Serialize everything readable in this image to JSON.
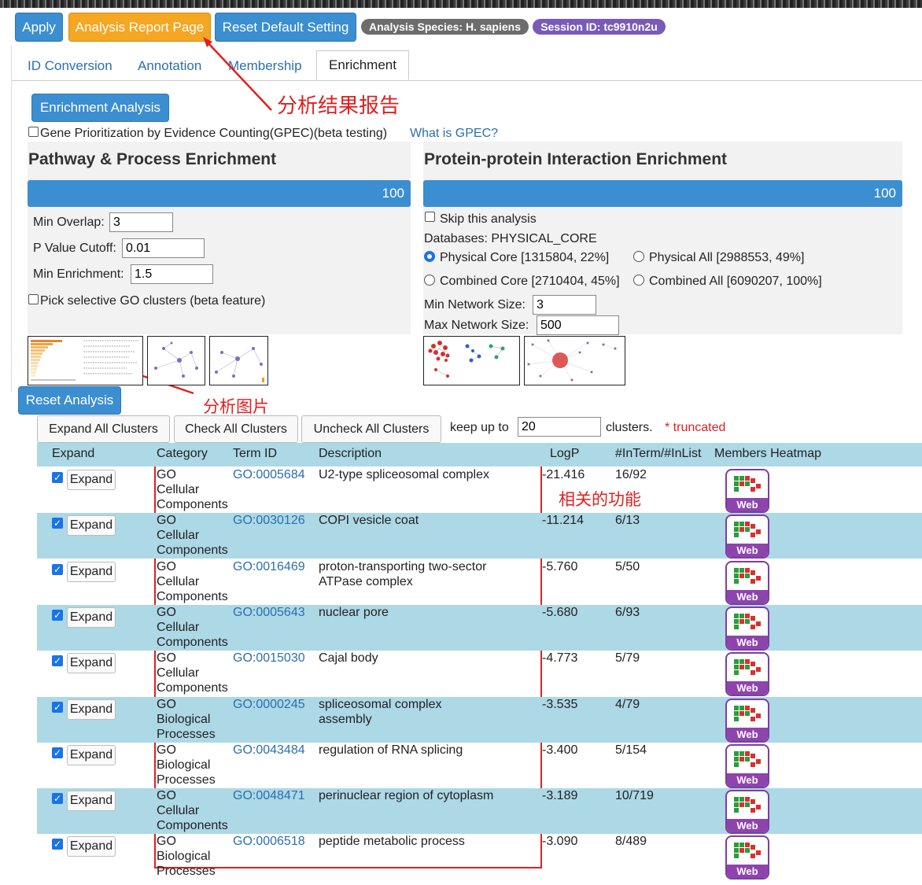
{
  "toolbar": {
    "apply": "Apply",
    "report": "Analysis Report Page",
    "reset_default": "Reset Default Setting",
    "species_badge": "Analysis Species: H. sapiens",
    "session_badge": "Session ID: tc9910n2u"
  },
  "tabs": [
    "ID Conversion",
    "Annotation",
    "Membership",
    "Enrichment"
  ],
  "enrichment": {
    "button": "Enrichment Analysis",
    "gpec_label": "Gene Prioritization by Evidence Counting(GPEC)(beta testing)",
    "gpec_link": "What is GPEC?"
  },
  "pathway": {
    "title": "Pathway & Process Enrichment",
    "progress": "100",
    "min_overlap_label": "Min Overlap:",
    "min_overlap": "3",
    "pvalue_label": "P Value Cutoff:",
    "pvalue": "0.01",
    "min_enrich_label": "Min Enrichment:",
    "min_enrich": "1.5",
    "pick_label": "Pick selective GO clusters (beta feature)"
  },
  "ppi": {
    "title": "Protein-protein Interaction Enrichment",
    "progress": "100",
    "skip_label": "Skip this analysis",
    "databases": "Databases: PHYSICAL_CORE",
    "opt1": "Physical Core [1315804, 22%]",
    "opt2": "Physical All [2988553, 49%]",
    "opt3": "Combined Core [2710404, 45%]",
    "opt4": "Combined All [6090207, 100%]",
    "min_net_label": "Min Network Size:",
    "min_net": "3",
    "max_net_label": "Max Network Size:",
    "max_net": "500"
  },
  "annotations": {
    "report_note": "分析结果报告",
    "image_note": "分析图片",
    "function_note": "相关的功能"
  },
  "controls": {
    "reset_analysis": "Reset Analysis",
    "expand_all": "Expand All Clusters",
    "check_all": "Check All Clusters",
    "uncheck_all": "Uncheck All Clusters",
    "keep_up_to": "keep up to",
    "keep_value": "20",
    "clusters": "clusters.",
    "truncated": "* truncated"
  },
  "table": {
    "headers": [
      "Expand",
      "Category",
      "Term ID",
      "Description",
      "LogP",
      "#InTerm/#InList",
      "Members Heatmap"
    ],
    "expand_label": "Expand",
    "web_label": "Web",
    "rows": [
      {
        "cat": [
          "GO",
          "Cellular",
          "Components"
        ],
        "term": "GO:0005684",
        "desc": [
          "U2-type spliceosomal complex"
        ],
        "logp": "-21.416",
        "ratio": "16/92"
      },
      {
        "cat": [
          "GO",
          "Cellular",
          "Components"
        ],
        "term": "GO:0030126",
        "desc": [
          "COPI vesicle coat"
        ],
        "logp": "-11.214",
        "ratio": "6/13"
      },
      {
        "cat": [
          "GO",
          "Cellular",
          "Components"
        ],
        "term": "GO:0016469",
        "desc": [
          "proton-transporting two-sector",
          "ATPase complex"
        ],
        "logp": "-5.760",
        "ratio": "5/50"
      },
      {
        "cat": [
          "GO",
          "Cellular",
          "Components"
        ],
        "term": "GO:0005643",
        "desc": [
          "nuclear pore"
        ],
        "logp": "-5.680",
        "ratio": "6/93"
      },
      {
        "cat": [
          "GO",
          "Cellular",
          "Components"
        ],
        "term": "GO:0015030",
        "desc": [
          "Cajal body"
        ],
        "logp": "-4.773",
        "ratio": "5/79"
      },
      {
        "cat": [
          "GO",
          "Biological",
          "Processes"
        ],
        "term": "GO:0000245",
        "desc": [
          "spliceosomal complex",
          "assembly"
        ],
        "logp": "-3.535",
        "ratio": "4/79"
      },
      {
        "cat": [
          "GO",
          "Biological",
          "Processes"
        ],
        "term": "GO:0043484",
        "desc": [
          "regulation of RNA splicing"
        ],
        "logp": "-3.400",
        "ratio": "5/154"
      },
      {
        "cat": [
          "GO",
          "Cellular",
          "Components"
        ],
        "term": "GO:0048471",
        "desc": [
          "perinuclear region of cytoplasm"
        ],
        "logp": "-3.189",
        "ratio": "10/719"
      },
      {
        "cat": [
          "GO",
          "Biological",
          "Processes"
        ],
        "term": "GO:0006518",
        "desc": [
          "peptide metabolic process"
        ],
        "logp": "-3.090",
        "ratio": "8/489"
      }
    ]
  },
  "colors": {
    "blue": "#3b8ed0",
    "orange": "#f5a623",
    "purple": "#8e44ad",
    "row": "#add8e6",
    "red": "#e02020"
  }
}
